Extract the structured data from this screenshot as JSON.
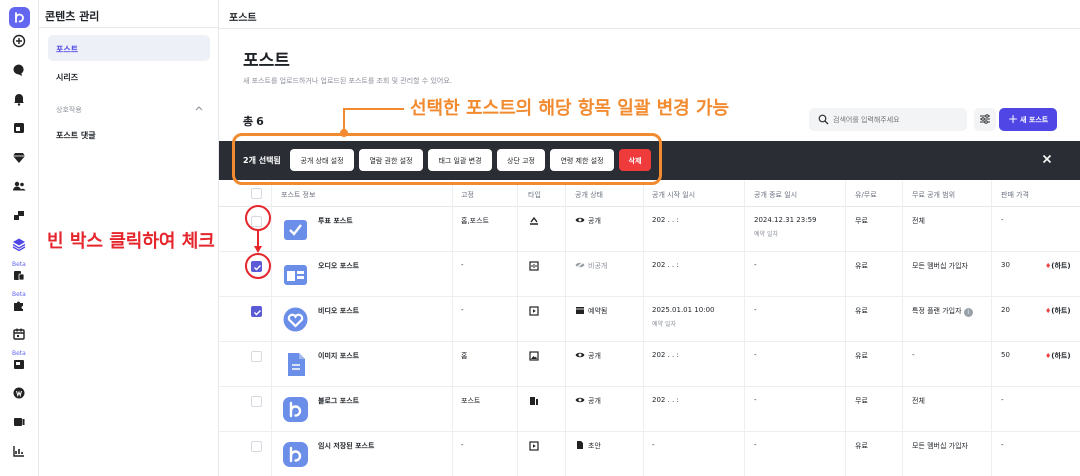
{
  "sidebar": {
    "title": "콘텐츠 관리",
    "items": [
      {
        "label": "포스트"
      },
      {
        "label": "시리즈"
      }
    ],
    "group": "상호작용",
    "group_items": [
      {
        "label": "포스트 댓글"
      }
    ]
  },
  "rail": {
    "beta_label": "Beta"
  },
  "header": {
    "breadcrumb": "포스트"
  },
  "page": {
    "title": "포스트",
    "description": "새 포스트를 업로드하거나 업로드된 포스트를 조회 및 관리할 수 있어요.",
    "total_label": "총",
    "total_count": "6"
  },
  "toolbar": {
    "search_placeholder": "검색어를 입력해주세요",
    "new_post_label": "새 포스트"
  },
  "bulk_bar": {
    "selected_text": "2개 선택됨",
    "actions": [
      {
        "label": "공개 상태 설정"
      },
      {
        "label": "열람 권한 설정"
      },
      {
        "label": "태그 일괄 변경"
      },
      {
        "label": "상단 고정"
      },
      {
        "label": "연령 제한 설정"
      },
      {
        "label": "삭제"
      }
    ]
  },
  "table": {
    "columns": [
      "포스트 정보",
      "고정",
      "타입",
      "공개 상태",
      "공개 시작 일시",
      "공개 종료 일시",
      "유/무료",
      "무료 공개 범위",
      "판매 가격"
    ],
    "rows": [
      {
        "title": "투표 포스트",
        "pinned": "홈,포스트",
        "status": "공개",
        "start": "202  .   .      :",
        "end": "2024.12.31 23:59",
        "end_sub": "예약 일자",
        "paid": "무료",
        "free_range": "전체",
        "price": "-",
        "price_unit": ""
      },
      {
        "title": "오디오 포스트",
        "pinned": "-",
        "status": "비공개",
        "start": "202  .   .      :",
        "end": "-",
        "end_sub": "",
        "paid": "유료",
        "free_range": "모든 멤버십 가입자",
        "price": "30",
        "price_unit": "(하트)"
      },
      {
        "title": "비디오 포스트",
        "pinned": "-",
        "status": "예약됨",
        "start": "2025.01.01 10:00",
        "start_sub": "예약 일자",
        "end": "-",
        "end_sub": "",
        "paid": "유료",
        "free_range": "특정 플랜 가입자",
        "price": "20",
        "price_unit": "(하트)"
      },
      {
        "title": "이미지 포스트",
        "pinned": "홈",
        "status": "공개",
        "start": "202  .   .      :",
        "end": "-",
        "end_sub": "",
        "paid": "유료",
        "free_range": "-",
        "price": "50",
        "price_unit": "(하트)"
      },
      {
        "title": "블로그 포스트",
        "pinned": "포스트",
        "status": "공개",
        "start": "202  .   .      :",
        "end": "-",
        "end_sub": "",
        "paid": "무료",
        "free_range": "전체",
        "price": "-",
        "price_unit": ""
      },
      {
        "title": "임시 저장된 포스트",
        "pinned": "-",
        "status": "초안",
        "start": "-",
        "end": "-",
        "end_sub": "",
        "paid": "유료",
        "free_range": "모든 멤버십 가입자",
        "price": "-",
        "price_unit": ""
      }
    ]
  },
  "annotations": {
    "bulk_note": "선택한 포스트의 해당 항목 일괄 변경 가능",
    "checkbox_note": "빈 박스 클릭하여 체크"
  },
  "colors": {
    "accent": "#4f46e5",
    "annotation_orange": "#f28b30",
    "annotation_red": "#e5262c",
    "delete": "#ef3b3b"
  }
}
